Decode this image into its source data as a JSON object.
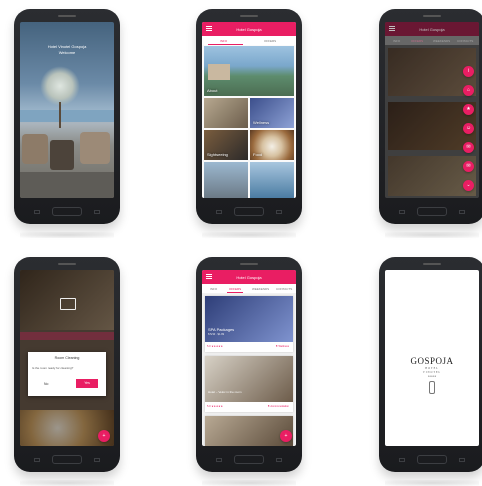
{
  "colors": {
    "accent": "#e91e63",
    "phone": "#2b2d31"
  },
  "welcome": {
    "line1": "Hotel Vinotel Gospoja",
    "line2": "Welcome"
  },
  "appbar": {
    "title": "Hotel Gospoja"
  },
  "phone2": {
    "tabs": [
      "INFO",
      "OFFERS"
    ],
    "tiles": [
      "About",
      "Wellness",
      "Sightseeing",
      "Food"
    ]
  },
  "phone3": {
    "tabs": [
      "INFO",
      "OFFERS",
      "WEEKENDS",
      "CONTACTS"
    ],
    "fab_icons": [
      "i",
      "⌂",
      "★",
      "☺",
      "✉",
      "✉",
      "⌄"
    ]
  },
  "dialog": {
    "title": "Room Cleaning",
    "message": "Is the room ready for cleaning?",
    "no": "No",
    "yes": "Yes"
  },
  "phone5": {
    "tabs": [
      "INFO",
      "OFFERS",
      "WEEKENDS",
      "CONTACTS"
    ],
    "cards": [
      {
        "title": "SPA Packages",
        "subtitle": "8.5/10 · $1.99",
        "rating": "5.0 ★★★★★",
        "link": "⚑ Wellness"
      },
      {
        "title": "Hotel – Veloc in the room",
        "subtitle": "",
        "rating": "5.0 ★★★★★",
        "link": "⚑ Accommodation"
      }
    ],
    "fab": "+"
  },
  "splash": {
    "brand": "GOSPOJA",
    "sub1": "HOTEL",
    "sub2": "VINOTEL",
    "stars": "★★★★"
  }
}
